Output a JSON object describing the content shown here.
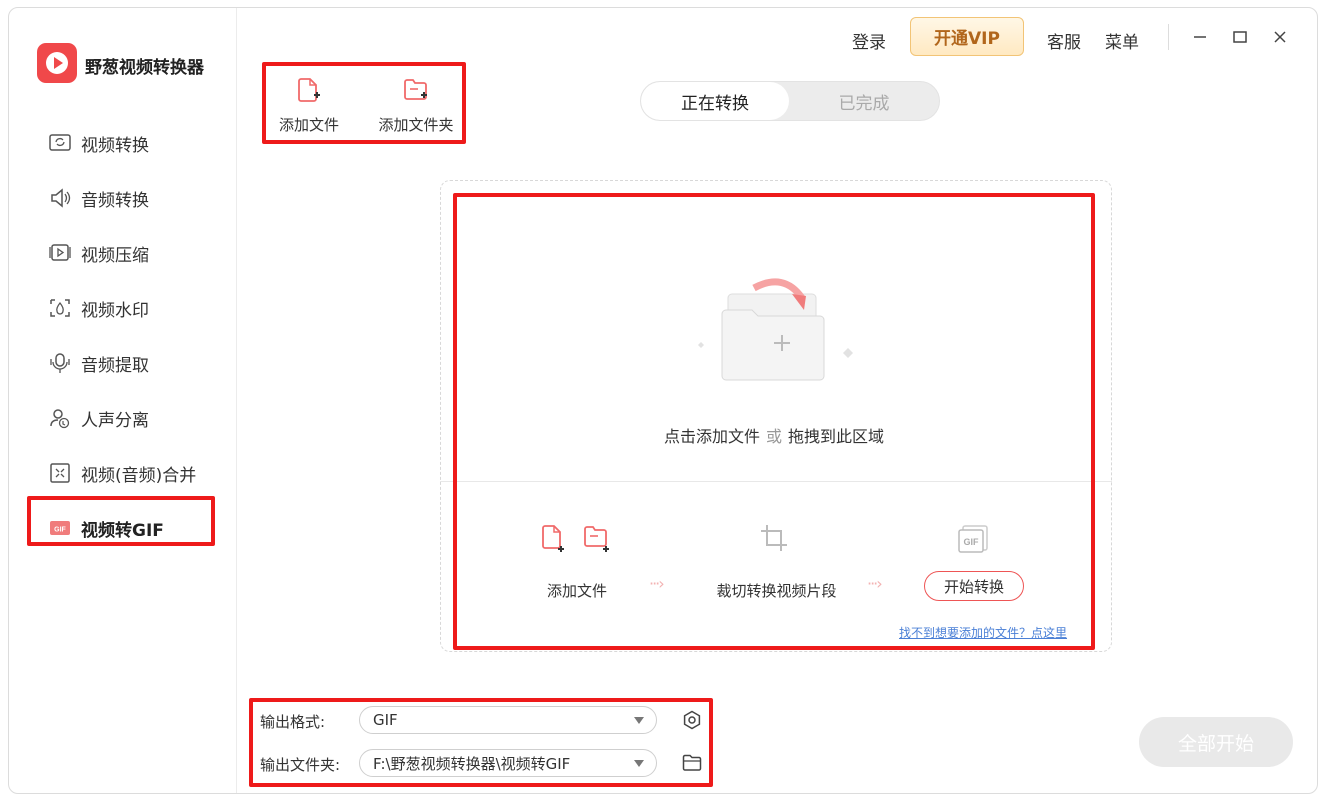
{
  "app": {
    "title": "野葱视频转换器",
    "logo_icon": "play-logo-icon",
    "brand_color": "#f0484a"
  },
  "topbar": {
    "login": "登录",
    "vip": "开通VIP",
    "service": "客服",
    "menu": "菜单"
  },
  "sidebar": {
    "items": [
      {
        "label": "视频转换",
        "icon": "video-convert-icon"
      },
      {
        "label": "音频转换",
        "icon": "audio-convert-icon"
      },
      {
        "label": "视频压缩",
        "icon": "video-compress-icon"
      },
      {
        "label": "视频水印",
        "icon": "video-watermark-icon"
      },
      {
        "label": "音频提取",
        "icon": "audio-extract-icon"
      },
      {
        "label": "人声分离",
        "icon": "vocal-separate-icon"
      },
      {
        "label": "视频(音频)合并",
        "icon": "merge-icon"
      },
      {
        "label": "视频转GIF",
        "icon": "gif-icon",
        "active": true
      }
    ]
  },
  "toolbar": {
    "add_file": "添加文件",
    "add_folder": "添加文件夹"
  },
  "tabs": {
    "converting": "正在转换",
    "done": "已完成"
  },
  "dropzone": {
    "click_add": "点击添加文件",
    "or": "或",
    "drag": "拖拽到此区域",
    "steps": {
      "add_file": "添加文件",
      "crop": "裁切转换视频片段",
      "start": "开始转换"
    },
    "help_link": "找不到想要添加的文件？点这里"
  },
  "output": {
    "format_label": "输出格式:",
    "format_value": "GIF",
    "folder_label": "输出文件夹:",
    "folder_value": "F:\\野葱视频转换器\\视频转GIF"
  },
  "start_all": "全部开始",
  "colors": {
    "accent_red": "#ee1a1a",
    "icon_red": "#f06a6a"
  }
}
